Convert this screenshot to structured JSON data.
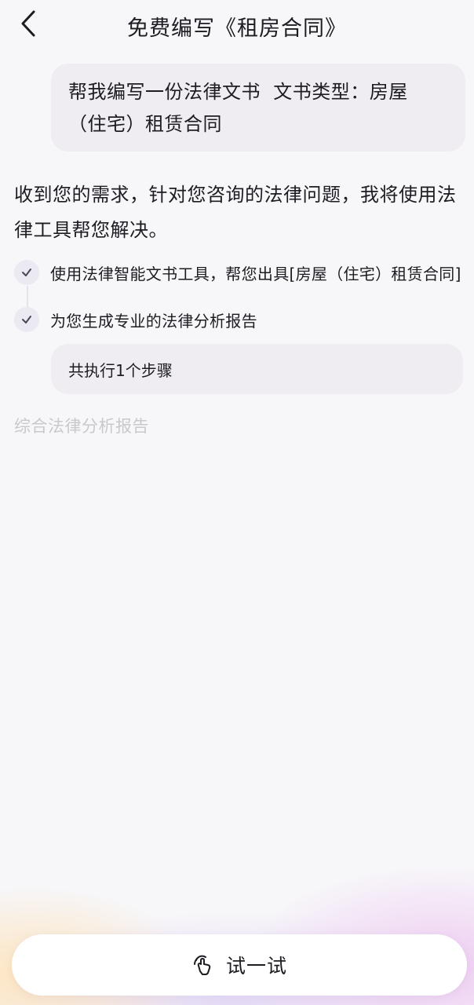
{
  "header": {
    "title": "免费编写《租房合同》",
    "back_icon": "chevron-left-icon"
  },
  "user_message": {
    "text": "帮我编写一份法律文书  文书类型：房屋\n（住宅）租赁合同"
  },
  "assistant": {
    "reply": "收到您的需求，针对您咨询的法律问题，我将使用法律工具帮您解决。",
    "steps": [
      {
        "label": "使用法律智能文书工具，帮您出具[房屋（住宅）租赁合同]",
        "status": "done",
        "icon": "check-icon"
      },
      {
        "label": "为您生成专业的法律分析报告",
        "status": "done",
        "icon": "check-icon"
      }
    ],
    "execution_summary": "共执行1个步骤",
    "report_label": "综合法律分析报告"
  },
  "footer": {
    "try_label": "试一试",
    "try_icon": "touch-hand-icon"
  },
  "colors": {
    "background": "#f7f6f9",
    "bubble": "#efedf1",
    "text": "#1c1c22",
    "muted": "#c9c8cd",
    "check_circle": "#ebe9f1",
    "glow_orange": "#ffdeaa",
    "glow_pink": "#ecc4f0"
  }
}
